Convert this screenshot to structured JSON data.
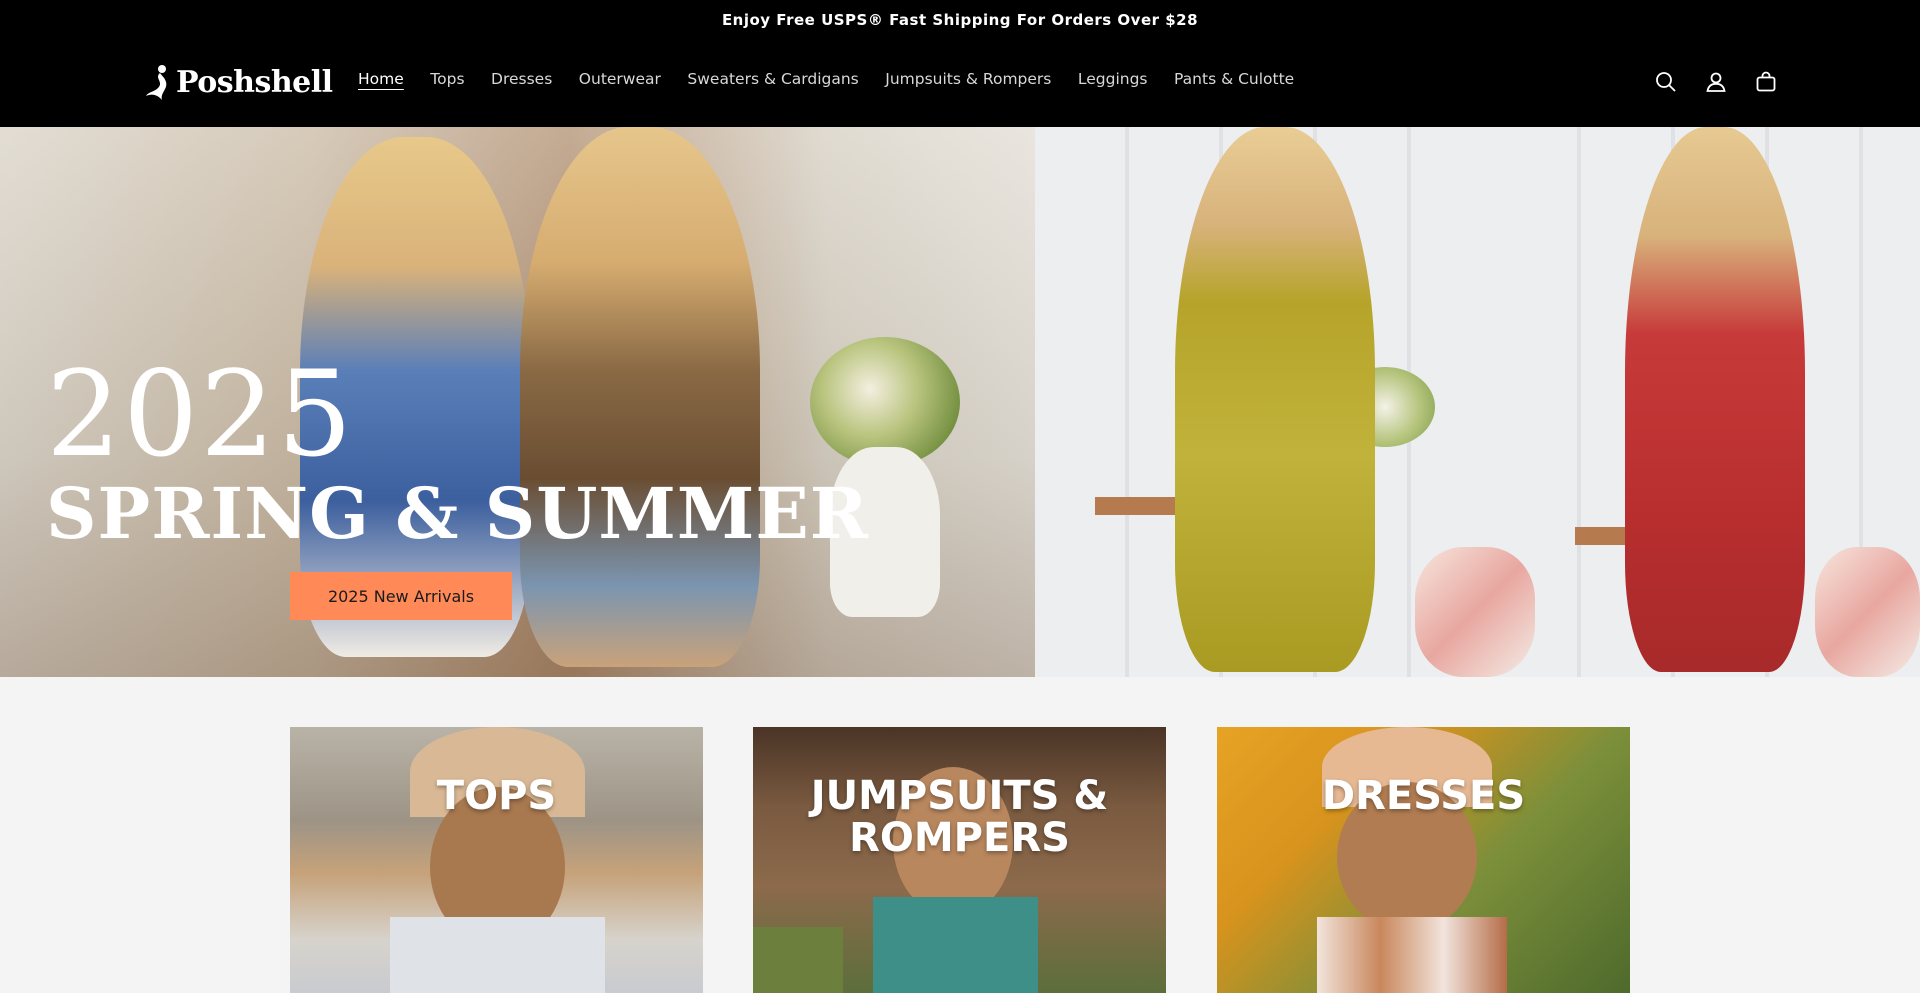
{
  "announcement": {
    "text": "Enjoy Free USPS® Fast Shipping For Orders Over $28"
  },
  "brand": {
    "name": "Poshshell",
    "icon": "logo-figure"
  },
  "nav": {
    "items": [
      {
        "label": "Home",
        "active": true
      },
      {
        "label": "Tops",
        "active": false
      },
      {
        "label": "Dresses",
        "active": false
      },
      {
        "label": "Outerwear",
        "active": false
      },
      {
        "label": "Sweaters & Cardigans",
        "active": false
      },
      {
        "label": "Jumpsuits & Rompers",
        "active": false
      },
      {
        "label": "Leggings",
        "active": false
      },
      {
        "label": "Pants & Culotte",
        "active": false
      }
    ]
  },
  "header_icons": [
    "search-icon",
    "account-icon",
    "cart-icon"
  ],
  "hero": {
    "year": "2025",
    "headline": "SPRING & SUMMER",
    "cta_label": "2025 New Arrivals",
    "cta_color": "#ff8a57"
  },
  "collections": [
    {
      "title": "TOPS"
    },
    {
      "title": "JUMPSUITS & ROMPERS"
    },
    {
      "title": "DRESSES"
    }
  ],
  "colors": {
    "header_bg": "#000000",
    "page_bg": "#f4f4f4",
    "text_light": "#ffffff"
  }
}
